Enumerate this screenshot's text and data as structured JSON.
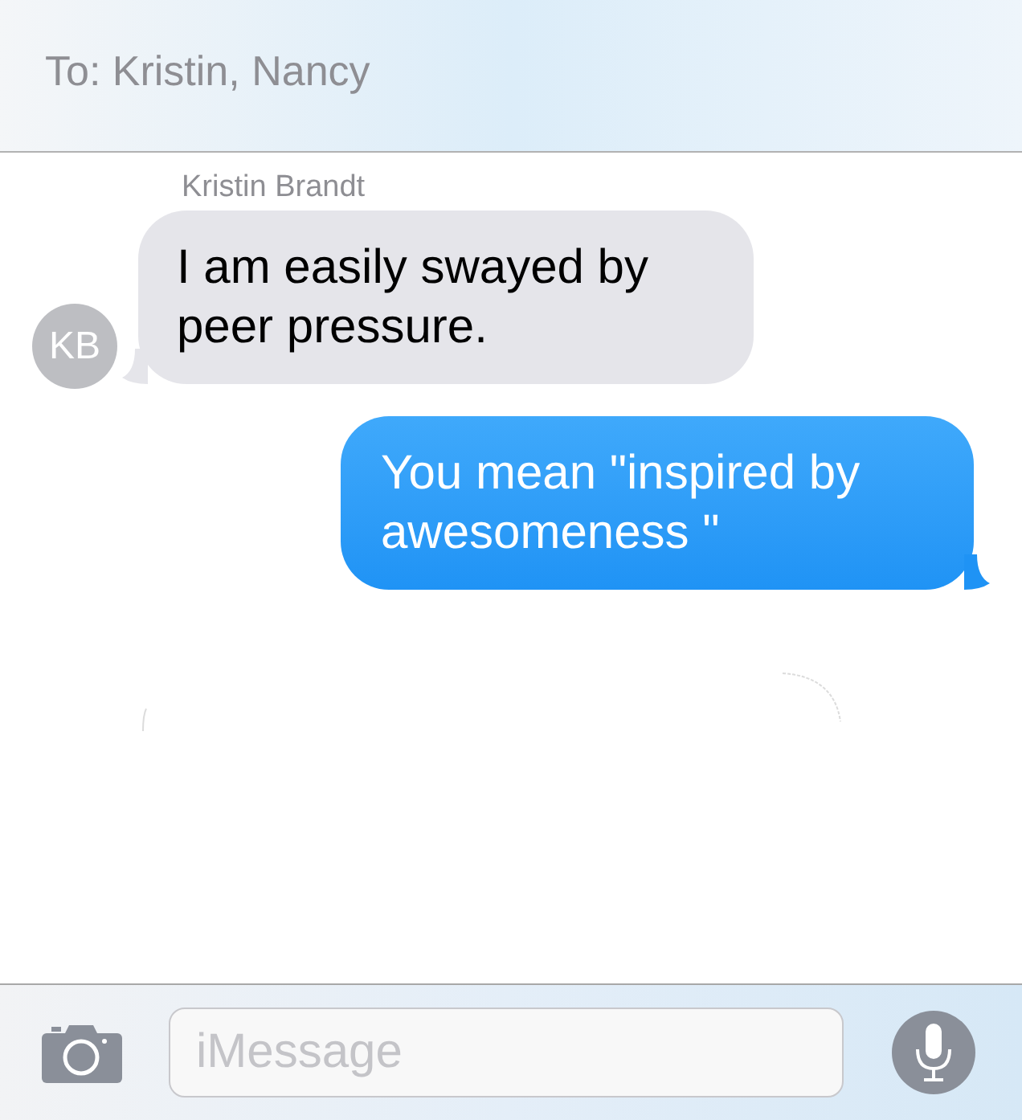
{
  "header": {
    "recipients": "To: Kristin, Nancy"
  },
  "messages": [
    {
      "kind": "incoming",
      "sender": "Kristin Brandt",
      "avatar": "KB",
      "text": "I am easily swayed by peer pressure."
    },
    {
      "kind": "outgoing",
      "text": "You mean \"inspired by awesomeness \""
    }
  ],
  "composer": {
    "placeholder": "iMessage"
  }
}
